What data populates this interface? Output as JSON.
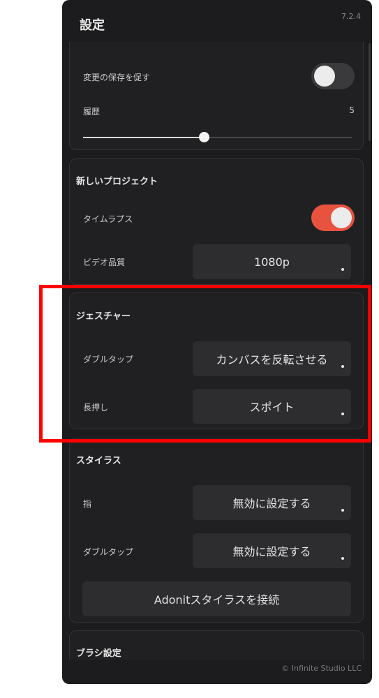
{
  "header": {
    "title": "設定",
    "version": "7.2.4"
  },
  "general": {
    "prompt_save_label": "変更の保存を促す",
    "prompt_save_on": false,
    "history_label": "履歴",
    "history_value": "5",
    "history_slider_fraction": 0.45
  },
  "new_project": {
    "title": "新しいプロジェクト",
    "timelapse_label": "タイムラプス",
    "timelapse_on": true,
    "video_quality_label": "ビデオ品質",
    "video_quality_value": "1080p"
  },
  "gestures": {
    "title": "ジェスチャー",
    "double_tap_label": "ダブルタップ",
    "double_tap_value": "カンバスを反転させる",
    "long_press_label": "長押し",
    "long_press_value": "スポイト"
  },
  "stylus": {
    "title": "スタイラス",
    "finger_label": "指",
    "finger_value": "無効に設定する",
    "double_tap_label": "ダブルタップ",
    "double_tap_value": "無効に設定する",
    "connect_button": "Adonitスタイラスを接続"
  },
  "brush": {
    "title": "ブラシ設定"
  },
  "footer": {
    "copyright": "© Infinite Studio LLC"
  },
  "colors": {
    "panel_bg": "#1c1c1e",
    "toggle_on": "#e8533f",
    "highlight": "#ff0000"
  }
}
